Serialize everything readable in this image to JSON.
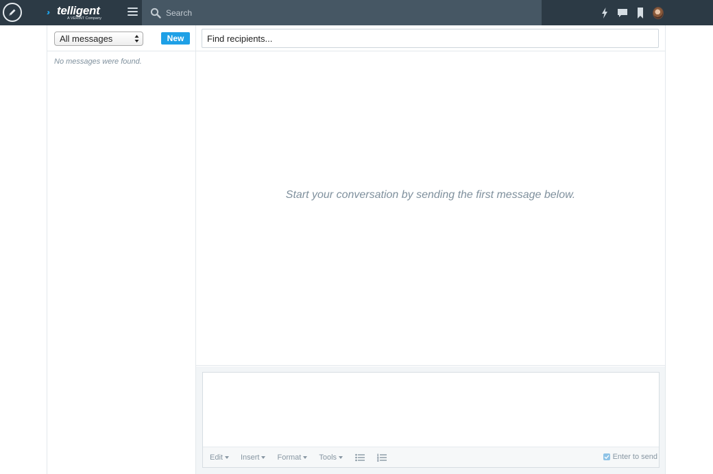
{
  "app": {
    "logo_text": "telligent",
    "logo_tagline": "A VERINT Company",
    "search_placeholder": "Search"
  },
  "icons": {
    "compose": "pencil-icon",
    "menu": "hamburger-icon",
    "search": "search-icon",
    "activity": "lightning-icon",
    "messages": "chat-icon",
    "bookmarks": "bookmark-icon",
    "avatar": "user-avatar"
  },
  "colors": {
    "topbar": "#2c3a45",
    "searchbar": "#465764",
    "accent": "#1ea0e6",
    "muted_text": "#7f909d"
  },
  "sidebar": {
    "filter_selected": "All messages",
    "new_label": "New",
    "empty_text": "No messages were found."
  },
  "conversation": {
    "recipients_placeholder": "Find recipients...",
    "hint": "Start your conversation by sending the first message below."
  },
  "composer": {
    "menus": [
      "Edit",
      "Insert",
      "Format",
      "Tools"
    ],
    "enter_to_send_label": "Enter to send",
    "enter_to_send_checked": true
  }
}
